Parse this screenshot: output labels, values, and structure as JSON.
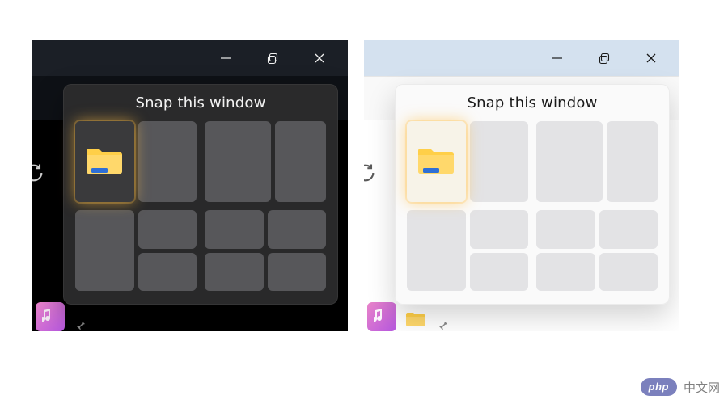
{
  "snap": {
    "title": "Snap this window"
  },
  "caption": {
    "minimize": "minimize",
    "maximize": "maximize",
    "close": "close"
  },
  "icons": {
    "folder": "folder-icon",
    "refresh": "refresh-icon",
    "music": "music-app-icon",
    "pin": "pin-icon"
  },
  "watermark": {
    "badge": "php",
    "text": "中文网"
  }
}
